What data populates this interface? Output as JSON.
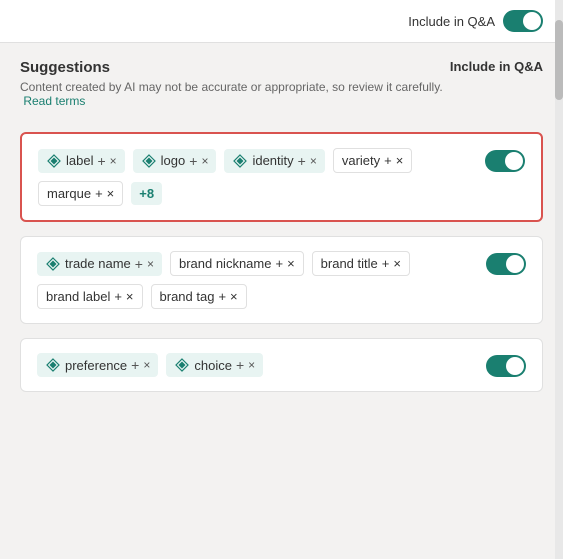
{
  "topBar": {
    "toggleLabel": "Include in Q&A",
    "toggleOn": true
  },
  "suggestions": {
    "title": "Suggestions",
    "subtitle": "Content created by AI may not be accurate or appropriate, so review it carefully.",
    "readTermsLabel": "Read terms",
    "includeQnaHeader": "Include in Q&A"
  },
  "cards": [
    {
      "id": "card1",
      "highlighted": true,
      "toggleOn": true,
      "tags": [
        {
          "type": "ai",
          "text": "label"
        },
        {
          "type": "ai",
          "text": "logo"
        },
        {
          "type": "ai",
          "text": "identity"
        },
        {
          "type": "plain",
          "text": "variety"
        },
        {
          "type": "plain",
          "text": "marque"
        },
        {
          "type": "more",
          "text": "+8"
        }
      ]
    },
    {
      "id": "card2",
      "highlighted": false,
      "toggleOn": true,
      "tags": [
        {
          "type": "ai",
          "text": "trade name"
        },
        {
          "type": "plain",
          "text": "brand nickname"
        },
        {
          "type": "plain",
          "text": "brand title"
        },
        {
          "type": "plain",
          "text": "brand label"
        },
        {
          "type": "plain",
          "text": "brand tag"
        }
      ]
    },
    {
      "id": "card3",
      "highlighted": false,
      "toggleOn": true,
      "tags": [
        {
          "type": "ai",
          "text": "preference"
        },
        {
          "type": "ai",
          "text": "choice"
        }
      ]
    }
  ],
  "icons": {
    "ai": "◈",
    "plus": "+",
    "close": "×"
  }
}
